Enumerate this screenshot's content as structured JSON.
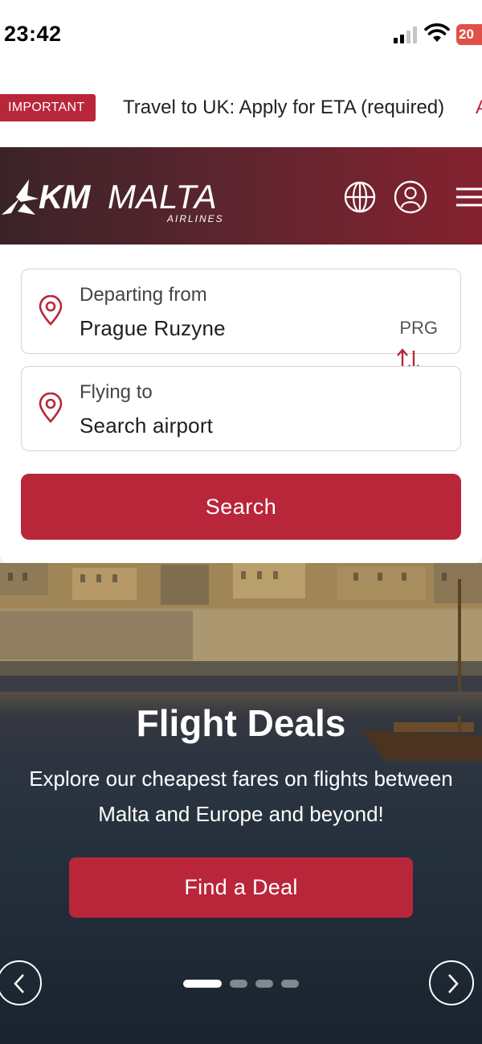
{
  "status_bar": {
    "time": "23:42",
    "battery": "20"
  },
  "alert": {
    "badge": "IMPORTANT",
    "text": "Travel to UK: Apply for ETA (required)",
    "more": "A"
  },
  "header": {
    "logo_km": "KM",
    "logo_malta": "MALTA",
    "logo_airlines": "AIRLINES"
  },
  "search": {
    "from": {
      "label": "Departing from",
      "value": "Prague Ruzyne",
      "code": "PRG"
    },
    "to": {
      "label": "Flying to",
      "value": "Search airport"
    },
    "button": "Search"
  },
  "hero": {
    "title": "Flight Deals",
    "subtitle_line1": "Explore our cheapest fares on flights between",
    "subtitle_line2": "Malta and Europe and beyond!",
    "button": "Find a Deal",
    "slides_total": 4,
    "slide_active": 1
  },
  "colors": {
    "brand": "#b9263a",
    "header_dark": "#3a2327",
    "header_red": "#85222f"
  },
  "icons": [
    "globe-icon",
    "user-icon",
    "menu-icon",
    "location-pin-icon",
    "swap-icon",
    "chevron-left-icon",
    "chevron-right-icon"
  ]
}
